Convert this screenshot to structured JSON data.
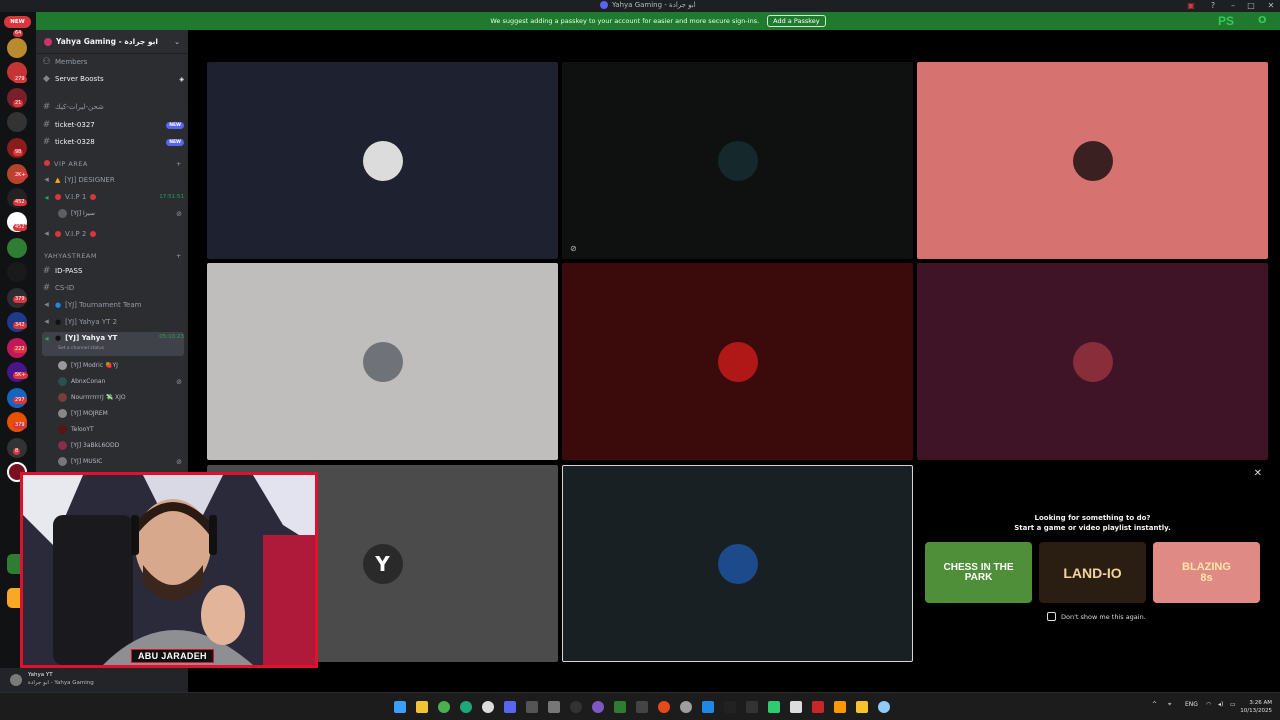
{
  "window": {
    "title": "Yahya Gaming - ابو جرادة"
  },
  "notice": {
    "text": "We suggest adding a passkey to your account for easier and more secure sign-ins.",
    "button": "Add a Passkey"
  },
  "brand_overlay": {
    "ps": "PS",
    "o": "O"
  },
  "rail": {
    "new_label": "NEW",
    "badges": [
      "64",
      "5",
      "279",
      "21",
      "98",
      "2K+",
      "452",
      "8",
      "379",
      "342",
      "222",
      "5K+",
      "297",
      "379",
      "8"
    ]
  },
  "sidebar": {
    "guild_name": "Yahya Gaming - ابو جرادة",
    "members": "Members",
    "server_boosts": "Server Boosts",
    "channels": [
      {
        "name": "شحن-ليرات-كيك"
      },
      {
        "name": "ticket-0327",
        "tag": "NEW"
      },
      {
        "name": "ticket-0328",
        "tag": "NEW"
      }
    ],
    "cat_vip": "VIP AREA",
    "vip_designer": "[YJ] DESIGNER",
    "vip1": "V.I.P 1",
    "vip1_time": "17:51:51",
    "vip1_user": "[YJ] سيزا",
    "vip2": "V.I.P 2",
    "cat_stream": "YAHYASTREAM",
    "id_pass": "ID-PASS",
    "cs_id": "CS-ID",
    "tournament": "[YJ] Tournament Team",
    "yahya_yt2": "[YJ] Yahya YT 2",
    "yahya_yt": "[YJ] Yahya YT",
    "yahya_yt_time": "05:10:23",
    "channel_status": "Set a channel status",
    "voice_users": [
      "[YJ] Modric 🍓YJ",
      "AbnxConan",
      "NourrrrrrrrJ 💸 XJO",
      "[YJ] MOJREM",
      "TelooYT",
      "[YJ] 3aBkL6ODD",
      "[YJ] MUSIC"
    ]
  },
  "activity": {
    "line1": "Looking for something to do?",
    "line2": "Start a game or video playlist instantly.",
    "games": [
      "CHESS IN THE PARK",
      "LAND-IO",
      "BLAZING 8s"
    ],
    "dont_show": "Don't show me this again."
  },
  "webcam": {
    "name": "ABU JARADEH"
  },
  "user_panel": {
    "name": "Yahya YT",
    "sub": "ابو جرادة - Yahya Gaming"
  },
  "taskbar": {
    "lang": "ENG",
    "time": "3:26 AM",
    "date": "10/13/2025"
  },
  "colors": {
    "tile1": "#1d2130",
    "tile2": "#0f1111",
    "tile3": "#d67370",
    "tile4": "#c0bebc",
    "tile5": "#3b0b0b",
    "tile6": "#3f1426",
    "tile7": "#4b4b4b",
    "tile8": "#182023",
    "notice": "#1f7a2f",
    "accent": "#5865f2"
  }
}
